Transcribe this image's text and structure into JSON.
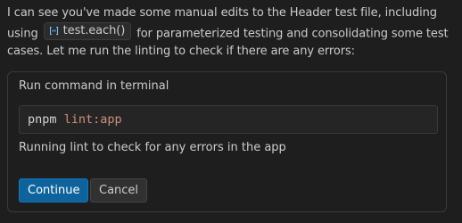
{
  "message": {
    "part1": "I can see you've made some manual edits to the Header test file, including using",
    "code_chip": {
      "icon": "symbol-method-icon",
      "label": "test.each()"
    },
    "part2": "for parameterized testing and consolidating some test cases. Let me run the linting to check if there are any errors:"
  },
  "terminal_card": {
    "title": "Run command in terminal",
    "command": {
      "bin": "pnpm",
      "arg": "lint:app"
    },
    "description": "Running lint to check for any errors in the app",
    "buttons": {
      "continue_label": "Continue",
      "cancel_label": "Cancel"
    }
  },
  "colors": {
    "background": "#1e1e1e",
    "text": "#cccccc",
    "primary_button": "#0e639c",
    "command_arg": "#ce9178",
    "chip_icon": "#75beff"
  }
}
